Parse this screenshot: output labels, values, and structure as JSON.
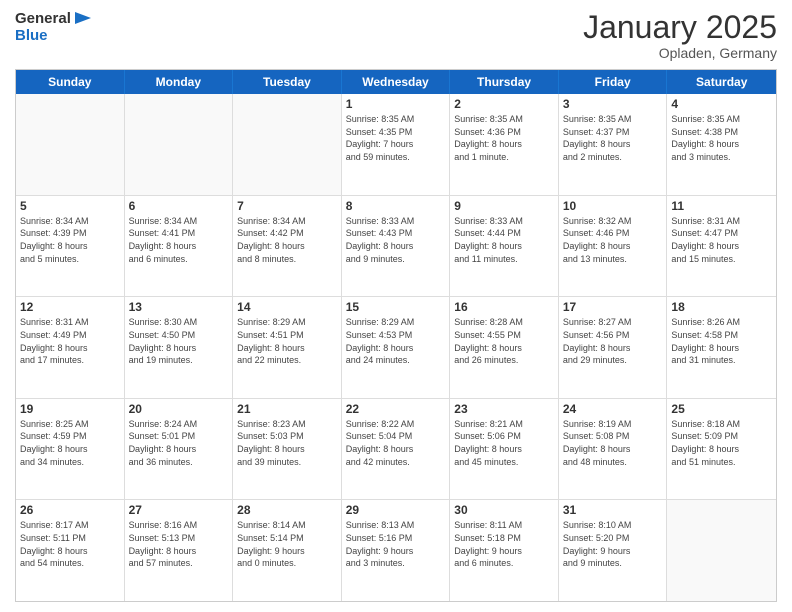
{
  "header": {
    "logo": {
      "text1": "General",
      "text2": "Blue"
    },
    "title": "January 2025",
    "location": "Opladen, Germany"
  },
  "calendar": {
    "weekdays": [
      "Sunday",
      "Monday",
      "Tuesday",
      "Wednesday",
      "Thursday",
      "Friday",
      "Saturday"
    ],
    "weeks": [
      [
        {
          "day": "",
          "detail": ""
        },
        {
          "day": "",
          "detail": ""
        },
        {
          "day": "",
          "detail": ""
        },
        {
          "day": "1",
          "detail": "Sunrise: 8:35 AM\nSunset: 4:35 PM\nDaylight: 7 hours\nand 59 minutes."
        },
        {
          "day": "2",
          "detail": "Sunrise: 8:35 AM\nSunset: 4:36 PM\nDaylight: 8 hours\nand 1 minute."
        },
        {
          "day": "3",
          "detail": "Sunrise: 8:35 AM\nSunset: 4:37 PM\nDaylight: 8 hours\nand 2 minutes."
        },
        {
          "day": "4",
          "detail": "Sunrise: 8:35 AM\nSunset: 4:38 PM\nDaylight: 8 hours\nand 3 minutes."
        }
      ],
      [
        {
          "day": "5",
          "detail": "Sunrise: 8:34 AM\nSunset: 4:39 PM\nDaylight: 8 hours\nand 5 minutes."
        },
        {
          "day": "6",
          "detail": "Sunrise: 8:34 AM\nSunset: 4:41 PM\nDaylight: 8 hours\nand 6 minutes."
        },
        {
          "day": "7",
          "detail": "Sunrise: 8:34 AM\nSunset: 4:42 PM\nDaylight: 8 hours\nand 8 minutes."
        },
        {
          "day": "8",
          "detail": "Sunrise: 8:33 AM\nSunset: 4:43 PM\nDaylight: 8 hours\nand 9 minutes."
        },
        {
          "day": "9",
          "detail": "Sunrise: 8:33 AM\nSunset: 4:44 PM\nDaylight: 8 hours\nand 11 minutes."
        },
        {
          "day": "10",
          "detail": "Sunrise: 8:32 AM\nSunset: 4:46 PM\nDaylight: 8 hours\nand 13 minutes."
        },
        {
          "day": "11",
          "detail": "Sunrise: 8:31 AM\nSunset: 4:47 PM\nDaylight: 8 hours\nand 15 minutes."
        }
      ],
      [
        {
          "day": "12",
          "detail": "Sunrise: 8:31 AM\nSunset: 4:49 PM\nDaylight: 8 hours\nand 17 minutes."
        },
        {
          "day": "13",
          "detail": "Sunrise: 8:30 AM\nSunset: 4:50 PM\nDaylight: 8 hours\nand 19 minutes."
        },
        {
          "day": "14",
          "detail": "Sunrise: 8:29 AM\nSunset: 4:51 PM\nDaylight: 8 hours\nand 22 minutes."
        },
        {
          "day": "15",
          "detail": "Sunrise: 8:29 AM\nSunset: 4:53 PM\nDaylight: 8 hours\nand 24 minutes."
        },
        {
          "day": "16",
          "detail": "Sunrise: 8:28 AM\nSunset: 4:55 PM\nDaylight: 8 hours\nand 26 minutes."
        },
        {
          "day": "17",
          "detail": "Sunrise: 8:27 AM\nSunset: 4:56 PM\nDaylight: 8 hours\nand 29 minutes."
        },
        {
          "day": "18",
          "detail": "Sunrise: 8:26 AM\nSunset: 4:58 PM\nDaylight: 8 hours\nand 31 minutes."
        }
      ],
      [
        {
          "day": "19",
          "detail": "Sunrise: 8:25 AM\nSunset: 4:59 PM\nDaylight: 8 hours\nand 34 minutes."
        },
        {
          "day": "20",
          "detail": "Sunrise: 8:24 AM\nSunset: 5:01 PM\nDaylight: 8 hours\nand 36 minutes."
        },
        {
          "day": "21",
          "detail": "Sunrise: 8:23 AM\nSunset: 5:03 PM\nDaylight: 8 hours\nand 39 minutes."
        },
        {
          "day": "22",
          "detail": "Sunrise: 8:22 AM\nSunset: 5:04 PM\nDaylight: 8 hours\nand 42 minutes."
        },
        {
          "day": "23",
          "detail": "Sunrise: 8:21 AM\nSunset: 5:06 PM\nDaylight: 8 hours\nand 45 minutes."
        },
        {
          "day": "24",
          "detail": "Sunrise: 8:19 AM\nSunset: 5:08 PM\nDaylight: 8 hours\nand 48 minutes."
        },
        {
          "day": "25",
          "detail": "Sunrise: 8:18 AM\nSunset: 5:09 PM\nDaylight: 8 hours\nand 51 minutes."
        }
      ],
      [
        {
          "day": "26",
          "detail": "Sunrise: 8:17 AM\nSunset: 5:11 PM\nDaylight: 8 hours\nand 54 minutes."
        },
        {
          "day": "27",
          "detail": "Sunrise: 8:16 AM\nSunset: 5:13 PM\nDaylight: 8 hours\nand 57 minutes."
        },
        {
          "day": "28",
          "detail": "Sunrise: 8:14 AM\nSunset: 5:14 PM\nDaylight: 9 hours\nand 0 minutes."
        },
        {
          "day": "29",
          "detail": "Sunrise: 8:13 AM\nSunset: 5:16 PM\nDaylight: 9 hours\nand 3 minutes."
        },
        {
          "day": "30",
          "detail": "Sunrise: 8:11 AM\nSunset: 5:18 PM\nDaylight: 9 hours\nand 6 minutes."
        },
        {
          "day": "31",
          "detail": "Sunrise: 8:10 AM\nSunset: 5:20 PM\nDaylight: 9 hours\nand 9 minutes."
        },
        {
          "day": "",
          "detail": ""
        }
      ]
    ]
  }
}
